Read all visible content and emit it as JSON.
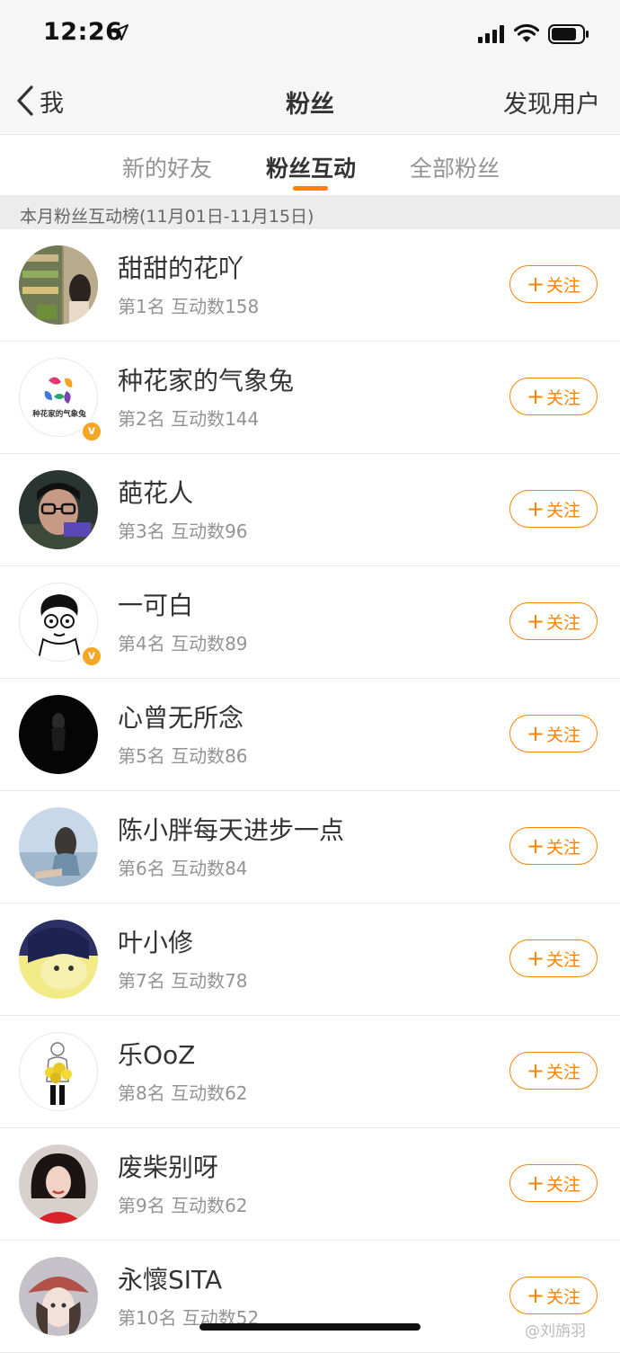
{
  "status_bar": {
    "time": "12:26"
  },
  "nav": {
    "back_label": "我",
    "title": "粉丝",
    "discover_label": "发现用户"
  },
  "tabs": [
    {
      "label": "新的好友",
      "active": false
    },
    {
      "label": "粉丝互动",
      "active": true
    },
    {
      "label": "全部粉丝",
      "active": false
    }
  ],
  "section_title": "本月粉丝互动榜(11月01日-11月15日)",
  "follow_label": "关注",
  "fans": [
    {
      "name": "甜甜的花吖",
      "meta": "第1名  互动数158",
      "verified": false
    },
    {
      "name": "种花家的气象兔",
      "meta": "第2名  互动数144",
      "verified": true,
      "avatar_text": "种花家的气象兔"
    },
    {
      "name": "葩花人",
      "meta": "第3名  互动数96",
      "verified": false
    },
    {
      "name": "一可白",
      "meta": "第4名  互动数89",
      "verified": true
    },
    {
      "name": "心曾无所念",
      "meta": "第5名  互动数86",
      "verified": false
    },
    {
      "name": "陈小胖每天进步一点",
      "meta": "第6名  互动数84",
      "verified": false
    },
    {
      "name": "叶小修",
      "meta": "第7名  互动数78",
      "verified": false
    },
    {
      "name": "乐OoZ",
      "meta": "第8名  互动数62",
      "verified": false
    },
    {
      "name": "废柴别呀",
      "meta": "第9名  互动数62",
      "verified": false
    },
    {
      "name": "永懷SITA",
      "meta": "第10名  互动数52",
      "verified": false
    }
  ],
  "watermark": "@刘旃羽",
  "colors": {
    "accent": "#ff8200",
    "verified": "#f5a623"
  }
}
